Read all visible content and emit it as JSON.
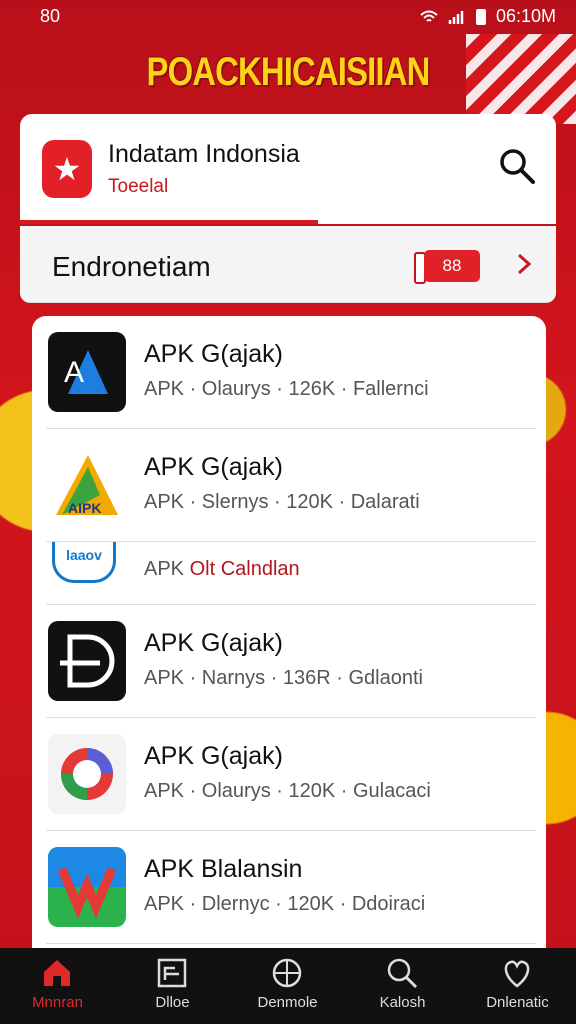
{
  "status": {
    "time_left": "80",
    "time_right": "06:10M"
  },
  "banner": {
    "text": "POACKHICAISIIAN"
  },
  "app": {
    "title": "Indatam Indonsia",
    "subtitle": "Toeelal"
  },
  "section": {
    "title": "Endronetiam",
    "badge": "88"
  },
  "list": {
    "items": [
      {
        "title": "APK G(ajak)",
        "meta": "APK · Olaurys · 126K · Fallernci",
        "icon": "android-studio-icon"
      },
      {
        "title": "APK G(ajak)",
        "meta": "APK · Slernys · 120K · Dalarati",
        "icon": "aipk-triangle-icon"
      },
      {
        "title_prefix": "APK",
        "title_red": "Olt Calndlan",
        "icon": "ad-label-icon",
        "icon_text": "laaov"
      },
      {
        "title": "APK G(ajak)",
        "meta": "APK · Narnys · 136R · Gdlaonti",
        "icon": "d-logo-icon"
      },
      {
        "title": "APK G(ajak)",
        "meta": "APK · Olaurys · 120K · Gulacaci",
        "icon": "ring-icon"
      },
      {
        "title": "APK Blalansin",
        "meta": "APK · Dlernyc · 120K · Ddoiraci",
        "icon": "wx-icon"
      }
    ]
  },
  "nav": {
    "items": [
      {
        "label": "Mnnran",
        "icon": "home-icon"
      },
      {
        "label": "Dlloe",
        "icon": "grid-icon"
      },
      {
        "label": "Denmole",
        "icon": "compass-icon"
      },
      {
        "label": "Kalosh",
        "icon": "search-icon"
      },
      {
        "label": "Dnlenatic",
        "icon": "heart-icon"
      }
    ]
  },
  "colors": {
    "accent": "#d61a22",
    "banner": "#ffd21a",
    "nav_bg": "#111111"
  }
}
